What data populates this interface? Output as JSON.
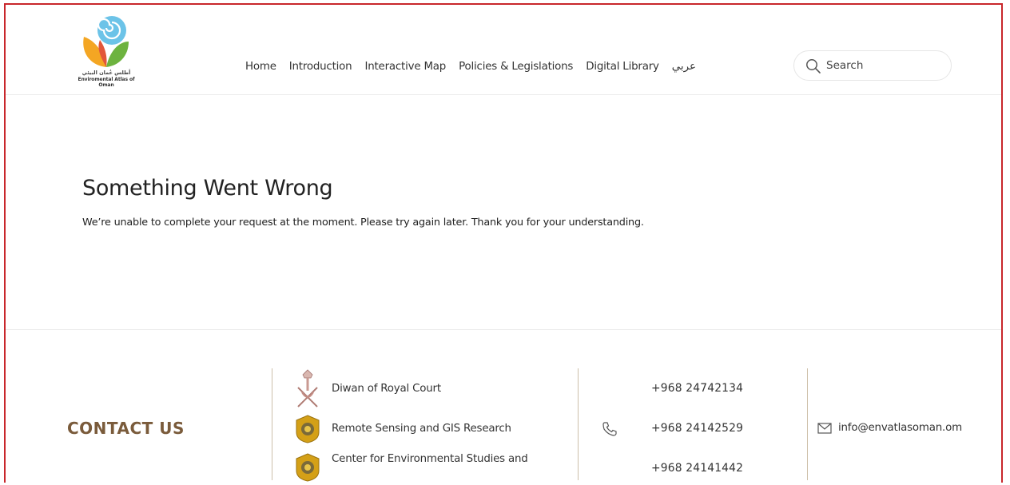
{
  "logo": {
    "arabic_name": "أطلس عُمان البيئي",
    "english_name": "Enviromental Atlas of Oman"
  },
  "nav": {
    "items": [
      {
        "label": "Home"
      },
      {
        "label": "Introduction"
      },
      {
        "label": "Interactive Map"
      },
      {
        "label": "Policies & Legislations"
      },
      {
        "label": "Digital Library"
      },
      {
        "label": "عربي"
      }
    ]
  },
  "search": {
    "placeholder": "Search"
  },
  "error": {
    "title": "Something Went Wrong",
    "message": "We’re unable to complete your request at the moment. Please try again later. Thank you for your understanding."
  },
  "footer": {
    "contact_title": "CONTACT US",
    "organizations": [
      {
        "name": "Diwan of Royal Court"
      },
      {
        "name": "Remote Sensing and GIS Research"
      },
      {
        "name": "Center for Environmental Studies and"
      }
    ],
    "phones": [
      "+968 24742134",
      "+968 24142529",
      "+968 24141442"
    ],
    "email": "info@envatlasoman.om"
  },
  "colors": {
    "frame_border": "#c8262b",
    "contact_title": "#7a5b3b",
    "divider": "#cdbfa9"
  },
  "icons": {
    "search": "search-icon",
    "phone": "phone-icon",
    "mail": "mail-icon",
    "emblem": "oman-emblem-icon",
    "seal": "university-seal-icon"
  }
}
